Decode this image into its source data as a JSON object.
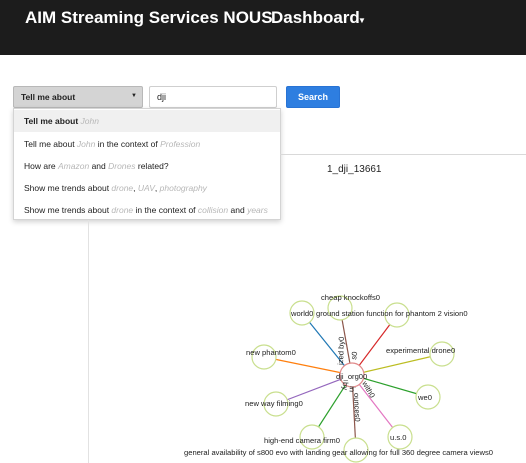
{
  "navbar": {
    "brand": "AIM Streaming Services NOUS",
    "dashboard": "Dashboard"
  },
  "search": {
    "select_label": "Tell me about",
    "input_value": "dji",
    "button_label": "Search"
  },
  "menu": {
    "items": [
      {
        "parts": [
          {
            "t": "Tell me about ",
            "ph": false
          },
          {
            "t": "John",
            "ph": true
          }
        ]
      },
      {
        "parts": [
          {
            "t": "Tell me about ",
            "ph": false
          },
          {
            "t": "John",
            "ph": true
          },
          {
            "t": " in the context of ",
            "ph": false
          },
          {
            "t": "Profession",
            "ph": true
          }
        ]
      },
      {
        "parts": [
          {
            "t": "How are ",
            "ph": false
          },
          {
            "t": "Amazon",
            "ph": true
          },
          {
            "t": " and ",
            "ph": false
          },
          {
            "t": "Drones",
            "ph": true
          },
          {
            "t": " related?",
            "ph": false
          }
        ]
      },
      {
        "parts": [
          {
            "t": "Show me trends about ",
            "ph": false
          },
          {
            "t": "drone",
            "ph": true
          },
          {
            "t": ", ",
            "ph": false
          },
          {
            "t": "UAV",
            "ph": true
          },
          {
            "t": ", ",
            "ph": false
          },
          {
            "t": "photography",
            "ph": true
          }
        ]
      },
      {
        "parts": [
          {
            "t": "Show me trends about ",
            "ph": false
          },
          {
            "t": "drone",
            "ph": true
          },
          {
            "t": " in the context of ",
            "ph": false
          },
          {
            "t": "collision",
            "ph": true
          },
          {
            "t": " and ",
            "ph": false
          },
          {
            "t": "years",
            "ph": true
          }
        ]
      }
    ]
  },
  "graph": {
    "title": "1_dji_13661",
    "center_label": "dji_org0",
    "nodes": [
      {
        "label": "cheap knockoffs0"
      },
      {
        "label": "world0"
      },
      {
        "label": "ground station function for phantom 2 vision0"
      },
      {
        "label": "new phantom0"
      },
      {
        "label": "experimental drone0"
      },
      {
        "label": "new way filming0"
      },
      {
        "label": "we0"
      },
      {
        "label": "high-end camera firm0"
      },
      {
        "label": "u.s.0"
      },
      {
        "label": "general availability of s800 evo with landing gear allowing for full 360 degree camera views0"
      }
    ],
    "edge_labels": [
      {
        "label": "ized by0"
      },
      {
        "label": "s0"
      },
      {
        "label": "by"
      },
      {
        "label": "in"
      },
      {
        "label": "with0"
      },
      {
        "label": "ounces0"
      },
      {
        "label": "0"
      }
    ],
    "colors": {
      "node_stroke": "#c9df8e",
      "edge_blue": "#1f77b4",
      "edge_orange": "#ff7f0e",
      "edge_red": "#d62728",
      "edge_purple": "#9467bd",
      "edge_green": "#2ca02c",
      "edge_pink": "#e377c2",
      "edge_brown": "#8c564b",
      "edge_olive": "#bcbd22"
    }
  }
}
